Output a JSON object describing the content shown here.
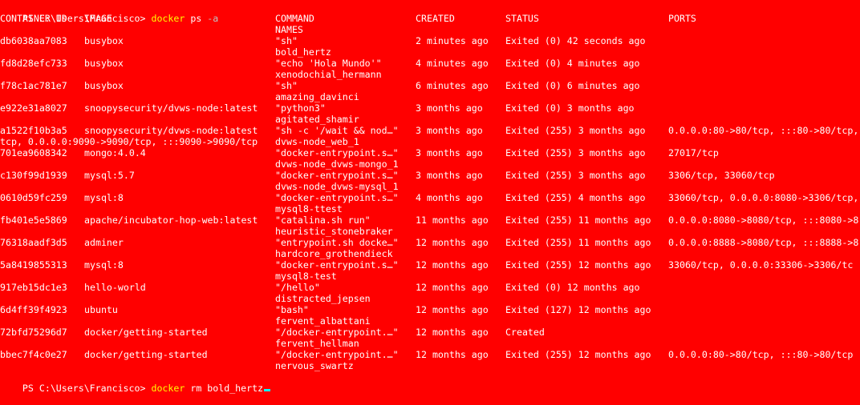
{
  "prompt": "PS C:\\Users\\Francisco>",
  "command1": {
    "name": "docker",
    "args": "ps",
    "flag": "-a"
  },
  "headers": [
    "CONTAINER ID",
    "IMAGE",
    "COMMAND",
    "CREATED",
    "STATUS",
    "PORTS",
    "NAMES"
  ],
  "rows": [
    {
      "id": "db6038aa7083",
      "image": "busybox",
      "command": "\"sh\"",
      "created": "2 minutes ago",
      "status": "Exited (0) 42 seconds ago",
      "ports": "",
      "name": "bold_hertz",
      "wrap": ""
    },
    {
      "id": "fd8d28efc733",
      "image": "busybox",
      "command": "\"echo 'Hola Mundo'\"",
      "created": "4 minutes ago",
      "status": "Exited (0) 4 minutes ago",
      "ports": "",
      "name": "xenodochial_hermann",
      "wrap": ""
    },
    {
      "id": "f78c1ac781e7",
      "image": "busybox",
      "command": "\"sh\"",
      "created": "6 minutes ago",
      "status": "Exited (0) 6 minutes ago",
      "ports": "",
      "name": "amazing_davinci",
      "wrap": ""
    },
    {
      "id": "e922e31a8027",
      "image": "snoopysecurity/dvws-node:latest",
      "command": "\"python3\"",
      "created": "3 months ago",
      "status": "Exited (0) 3 months ago",
      "ports": "",
      "name": "agitated_shamir",
      "wrap": ""
    },
    {
      "id": "a1522f10b3a5",
      "image": "snoopysecurity/dvws-node:latest",
      "command": "\"sh -c '/wait && nod…\"",
      "created": "3 months ago",
      "status": "Exited (255) 3 months ago",
      "ports": "0.0.0.0:80->80/tcp, :::80->80/tcp,",
      "name": "dvws-node_web_1",
      "wrap": "tcp, 0.0.0.0:9090->9090/tcp, :::9090->9090/tcp"
    },
    {
      "id": "701ea9608342",
      "image": "mongo:4.0.4",
      "command": "\"docker-entrypoint.s…\"",
      "created": "3 months ago",
      "status": "Exited (255) 3 months ago",
      "ports": "27017/tcp",
      "name": "dvws-node_dvws-mongo_1",
      "wrap": ""
    },
    {
      "id": "c130f99d1939",
      "image": "mysql:5.7",
      "command": "\"docker-entrypoint.s…\"",
      "created": "3 months ago",
      "status": "Exited (255) 3 months ago",
      "ports": "3306/tcp, 33060/tcp",
      "name": "dvws-node_dvws-mysql_1",
      "wrap": ""
    },
    {
      "id": "0610d59fc259",
      "image": "mysql:8",
      "command": "\"docker-entrypoint.s…\"",
      "created": "4 months ago",
      "status": "Exited (255) 4 months ago",
      "ports": "33060/tcp, 0.0.0.0:8080->3306/tcp,",
      "name": "mysql8-ttest",
      "wrap": ""
    },
    {
      "id": "fb401e5e5869",
      "image": "apache/incubator-hop-web:latest",
      "command": "\"catalina.sh run\"",
      "created": "11 months ago",
      "status": "Exited (255) 11 months ago",
      "ports": "0.0.0.0:8080->8080/tcp, :::8080->8",
      "name": "heuristic_stonebraker",
      "wrap": ""
    },
    {
      "id": "76318aadf3d5",
      "image": "adminer",
      "command": "\"entrypoint.sh docke…\"",
      "created": "12 months ago",
      "status": "Exited (255) 11 months ago",
      "ports": "0.0.0.0:8888->8080/tcp, :::8888->8",
      "name": "hardcore_grothendieck",
      "wrap": ""
    },
    {
      "id": "5a8419855313",
      "image": "mysql:8",
      "command": "\"docker-entrypoint.s…\"",
      "created": "12 months ago",
      "status": "Exited (255) 12 months ago",
      "ports": "33060/tcp, 0.0.0.0:33306->3306/tc",
      "name": "mysql8-test",
      "wrap": ""
    },
    {
      "id": "917eb15dc1e3",
      "image": "hello-world",
      "command": "\"/hello\"",
      "created": "12 months ago",
      "status": "Exited (0) 12 months ago",
      "ports": "",
      "name": "distracted_jepsen",
      "wrap": ""
    },
    {
      "id": "6d4ff39f4923",
      "image": "ubuntu",
      "command": "\"bash\"",
      "created": "12 months ago",
      "status": "Exited (127) 12 months ago",
      "ports": "",
      "name": "fervent_albattani",
      "wrap": ""
    },
    {
      "id": "72bfd75296d7",
      "image": "docker/getting-started",
      "command": "\"/docker-entrypoint.…\"",
      "created": "12 months ago",
      "status": "Created",
      "ports": "",
      "name": "fervent_hellman",
      "wrap": ""
    },
    {
      "id": "bbec7f4c0e27",
      "image": "docker/getting-started",
      "command": "\"/docker-entrypoint.…\"",
      "created": "12 months ago",
      "status": "Exited (255) 12 months ago",
      "ports": "0.0.0.0:80->80/tcp, :::80->80/tcp",
      "name": "nervous_swartz",
      "wrap": ""
    }
  ],
  "command2": {
    "name": "docker",
    "args": "rm bold_hertz"
  },
  "colors": {
    "background": "#ff0000",
    "text": "#ffffff",
    "command": "#ffff00",
    "flag": "#c0c0c0",
    "cursor": "#00ffff"
  }
}
